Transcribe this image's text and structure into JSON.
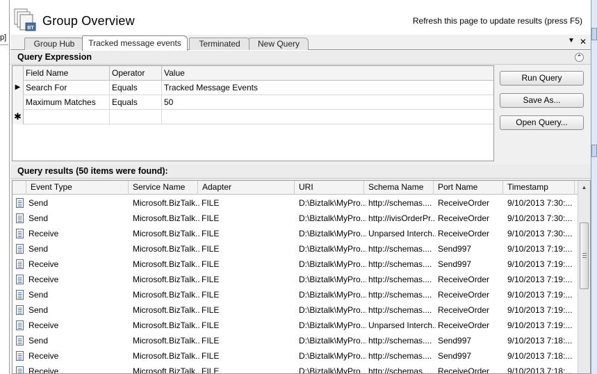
{
  "left_gutter": {
    "text": "p]"
  },
  "header": {
    "icon_label": "BT",
    "title": "Group Overview",
    "refresh_hint": "Refresh this page to update results (press F5)"
  },
  "tabs": [
    {
      "label": "Group Hub",
      "active": false
    },
    {
      "label": "Tracked message events",
      "active": true
    },
    {
      "label": "Terminated",
      "active": false
    },
    {
      "label": "New Query",
      "active": false
    }
  ],
  "tab_controls": {
    "menu": "▼",
    "close": "✕"
  },
  "query_expression": {
    "title": "Query Expression",
    "collapse_glyph": "⌃",
    "columns": [
      "Field Name",
      "Operator",
      "Value"
    ],
    "rows": [
      {
        "marker": "▶",
        "field": "Search For",
        "operator": "Equals",
        "value": "Tracked Message Events"
      },
      {
        "marker": "",
        "field": "Maximum Matches",
        "operator": "Equals",
        "value": "50"
      },
      {
        "marker": "✱",
        "field": "",
        "operator": "",
        "value": ""
      }
    ],
    "buttons": {
      "run": "Run Query",
      "save": "Save As...",
      "open": "Open Query..."
    }
  },
  "results": {
    "title": "Query results (50 items were found):",
    "columns": [
      "Event Type",
      "Service Name",
      "Adapter",
      "URI",
      "Schema Name",
      "Port Name",
      "Timestamp"
    ],
    "rows": [
      [
        "Send",
        "Microsoft.BizTalk...",
        "FILE",
        "D:\\Biztalk\\MyPro...",
        "http://schemas....",
        "ReceiveOrder",
        "9/10/2013 7:30:..."
      ],
      [
        "Send",
        "Microsoft.BizTalk...",
        "FILE",
        "D:\\Biztalk\\MyPro...",
        "http://ivisOrderPr...",
        "ReceiveOrder",
        "9/10/2013 7:30:..."
      ],
      [
        "Receive",
        "Microsoft.BizTalk...",
        "FILE",
        "D:\\Biztalk\\MyPro...",
        "Unparsed Interch...",
        "ReceiveOrder",
        "9/10/2013 7:30:..."
      ],
      [
        "Send",
        "Microsoft.BizTalk...",
        "FILE",
        "D:\\Biztalk\\MyPro...",
        "http://schemas....",
        "Send997",
        "9/10/2013 7:19:..."
      ],
      [
        "Receive",
        "Microsoft.BizTalk...",
        "FILE",
        "D:\\Biztalk\\MyPro...",
        "http://schemas....",
        "Send997",
        "9/10/2013 7:19:..."
      ],
      [
        "Receive",
        "Microsoft.BizTalk...",
        "FILE",
        "D:\\Biztalk\\MyPro...",
        "http://schemas....",
        "ReceiveOrder",
        "9/10/2013 7:19:..."
      ],
      [
        "Send",
        "Microsoft.BizTalk...",
        "FILE",
        "D:\\Biztalk\\MyPro...",
        "http://schemas....",
        "ReceiveOrder",
        "9/10/2013 7:19:..."
      ],
      [
        "Send",
        "Microsoft.BizTalk...",
        "FILE",
        "D:\\Biztalk\\MyPro...",
        "http://schemas....",
        "ReceiveOrder",
        "9/10/2013 7:19:..."
      ],
      [
        "Receive",
        "Microsoft.BizTalk...",
        "FILE",
        "D:\\Biztalk\\MyPro...",
        "Unparsed Interch...",
        "ReceiveOrder",
        "9/10/2013 7:19:..."
      ],
      [
        "Send",
        "Microsoft.BizTalk...",
        "FILE",
        "D:\\Biztalk\\MyPro...",
        "http://schemas....",
        "Send997",
        "9/10/2013 7:18:..."
      ],
      [
        "Receive",
        "Microsoft.BizTalk...",
        "FILE",
        "D:\\Biztalk\\MyPro...",
        "http://schemas....",
        "Send997",
        "9/10/2013 7:18:..."
      ],
      [
        "Receive",
        "Microsoft.BizTalk...",
        "FILE",
        "D:\\Biztalk\\MyPro...",
        "http://schemas....",
        "ReceiveOrder",
        "9/10/2013 7:18:..."
      ]
    ],
    "scroll_up_glyph": "▲"
  }
}
